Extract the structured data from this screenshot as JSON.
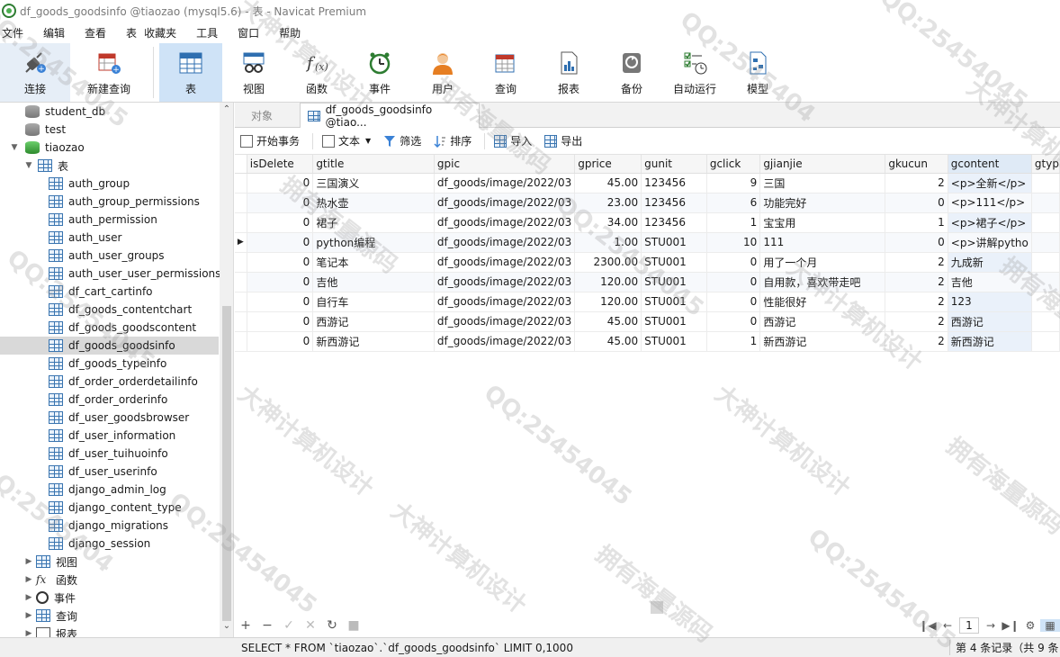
{
  "window": {
    "title": "df_goods_goodsinfo @tiaozao (mysql5.6) - 表 - Navicat Premium"
  },
  "menu": [
    "文件",
    "编辑",
    "查看",
    "表",
    "收藏夹",
    "工具",
    "窗口",
    "帮助"
  ],
  "toolbar": [
    {
      "label": "连接",
      "icon": "plug-icon"
    },
    {
      "label": "新建查询",
      "icon": "new-query-icon"
    },
    {
      "label": "表",
      "icon": "table-icon"
    },
    {
      "label": "视图",
      "icon": "view-icon"
    },
    {
      "label": "函数",
      "icon": "function-icon"
    },
    {
      "label": "事件",
      "icon": "clock-icon"
    },
    {
      "label": "用户",
      "icon": "user-icon"
    },
    {
      "label": "查询",
      "icon": "query-icon"
    },
    {
      "label": "报表",
      "icon": "report-icon"
    },
    {
      "label": "备份",
      "icon": "backup-icon"
    },
    {
      "label": "自动运行",
      "icon": "automation-icon"
    },
    {
      "label": "模型",
      "icon": "model-icon"
    }
  ],
  "sidebar": {
    "databases": [
      "student_db",
      "test",
      "tiaozao"
    ],
    "tables_group": "表",
    "tables": [
      "auth_group",
      "auth_group_permissions",
      "auth_permission",
      "auth_user",
      "auth_user_groups",
      "auth_user_user_permissions",
      "df_cart_cartinfo",
      "df_goods_contentchart",
      "df_goods_goodscontent",
      "df_goods_goodsinfo",
      "df_goods_typeinfo",
      "df_order_orderdetailinfo",
      "df_order_orderinfo",
      "df_user_goodsbrowser",
      "df_user_information",
      "df_user_tuihuoinfo",
      "df_user_userinfo",
      "django_admin_log",
      "django_content_type",
      "django_migrations",
      "django_session"
    ],
    "selected_table": "df_goods_goodsinfo",
    "groups": [
      "视图",
      "函数",
      "事件",
      "查询",
      "报表"
    ]
  },
  "tabs": {
    "objects": "对象",
    "current": "df_goods_goodsinfo @tiao..."
  },
  "subtoolbar": {
    "begin_transaction": "开始事务",
    "text": "文本",
    "filter": "筛选",
    "sort": "排序",
    "import": "导入",
    "export": "导出"
  },
  "grid": {
    "columns": [
      "isDelete",
      "gtitle",
      "gpic",
      "gprice",
      "gunit",
      "gclick",
      "gjianjie",
      "gkucun",
      "gcontent",
      "gtyp"
    ],
    "rows": [
      [
        "0",
        "三国演义",
        "df_goods/image/2022/03",
        "45.00",
        "123456",
        "9",
        "三国",
        "2",
        "<p>全新</p>"
      ],
      [
        "0",
        "热水壶",
        "df_goods/image/2022/03",
        "23.00",
        "123456",
        "6",
        "功能完好",
        "0",
        "<p>111</p>"
      ],
      [
        "0",
        "裙子",
        "df_goods/image/2022/03",
        "34.00",
        "123456",
        "1",
        "宝宝用",
        "1",
        "<p>裙子</p>"
      ],
      [
        "0",
        "python编程",
        "df_goods/image/2022/03",
        "1.00",
        "STU001",
        "10",
        "111",
        "0",
        "<p>讲解pytho"
      ],
      [
        "0",
        "笔记本",
        "df_goods/image/2022/03",
        "2300.00",
        "STU001",
        "0",
        "用了一个月",
        "2",
        "九成新"
      ],
      [
        "0",
        "吉他",
        "df_goods/image/2022/03",
        "120.00",
        "STU001",
        "0",
        "自用款，喜欢带走吧",
        "2",
        "吉他"
      ],
      [
        "0",
        "自行车",
        "df_goods/image/2022/03",
        "120.00",
        "STU001",
        "0",
        "性能很好",
        "2",
        "123"
      ],
      [
        "0",
        "西游记",
        "df_goods/image/2022/03",
        "45.00",
        "STU001",
        "0",
        "西游记",
        "2",
        "西游记"
      ],
      [
        "0",
        "新西游记",
        "df_goods/image/2022/03",
        "45.00",
        "STU001",
        "1",
        "新西游记",
        "2",
        "新西游记"
      ]
    ],
    "current_row_index": 3
  },
  "pager": {
    "page": "1"
  },
  "status": {
    "sql": "SELECT * FROM `tiaozao`.`df_goods_goodsinfo` LIMIT 0,1000",
    "records": "第 4 条记录（共 9 条"
  },
  "watermarks": [
    "QQ:25454045",
    "大神计算机设计",
    "拥有海量源码",
    "QQ:2545404",
    "QQ:25454045",
    "大神计算机设计",
    "拥有海量源码",
    "QQ:25454045",
    "大神计算机设计",
    "拥有海量源码",
    "QQ:25454045",
    "大神计算机设计"
  ]
}
